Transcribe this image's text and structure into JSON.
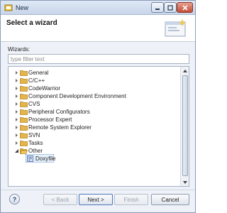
{
  "window": {
    "title": "New"
  },
  "header": {
    "title": "Select a wizard"
  },
  "wizards": {
    "label": "Wizards:",
    "filter_placeholder": "type filter text",
    "tree": [
      {
        "label": "General",
        "expanded": false
      },
      {
        "label": "C/C++",
        "expanded": false
      },
      {
        "label": "CodeWarrior",
        "expanded": false
      },
      {
        "label": "Component Development Environment",
        "expanded": false
      },
      {
        "label": "CVS",
        "expanded": false
      },
      {
        "label": "Peripheral Configurators",
        "expanded": false
      },
      {
        "label": "Processor Expert",
        "expanded": false
      },
      {
        "label": "Remote System Explorer",
        "expanded": false
      },
      {
        "label": "SVN",
        "expanded": false
      },
      {
        "label": "Tasks",
        "expanded": false
      },
      {
        "label": "Other",
        "expanded": true
      }
    ],
    "child": {
      "label": "Doxyfile",
      "selected": true
    }
  },
  "buttons": {
    "help": "?",
    "back": "< Back",
    "next": "Next >",
    "finish": "Finish",
    "cancel": "Cancel"
  },
  "colors": {
    "folder": "#e5b54c",
    "selection": "#e6f0fb",
    "accent": "#4c78b8"
  }
}
